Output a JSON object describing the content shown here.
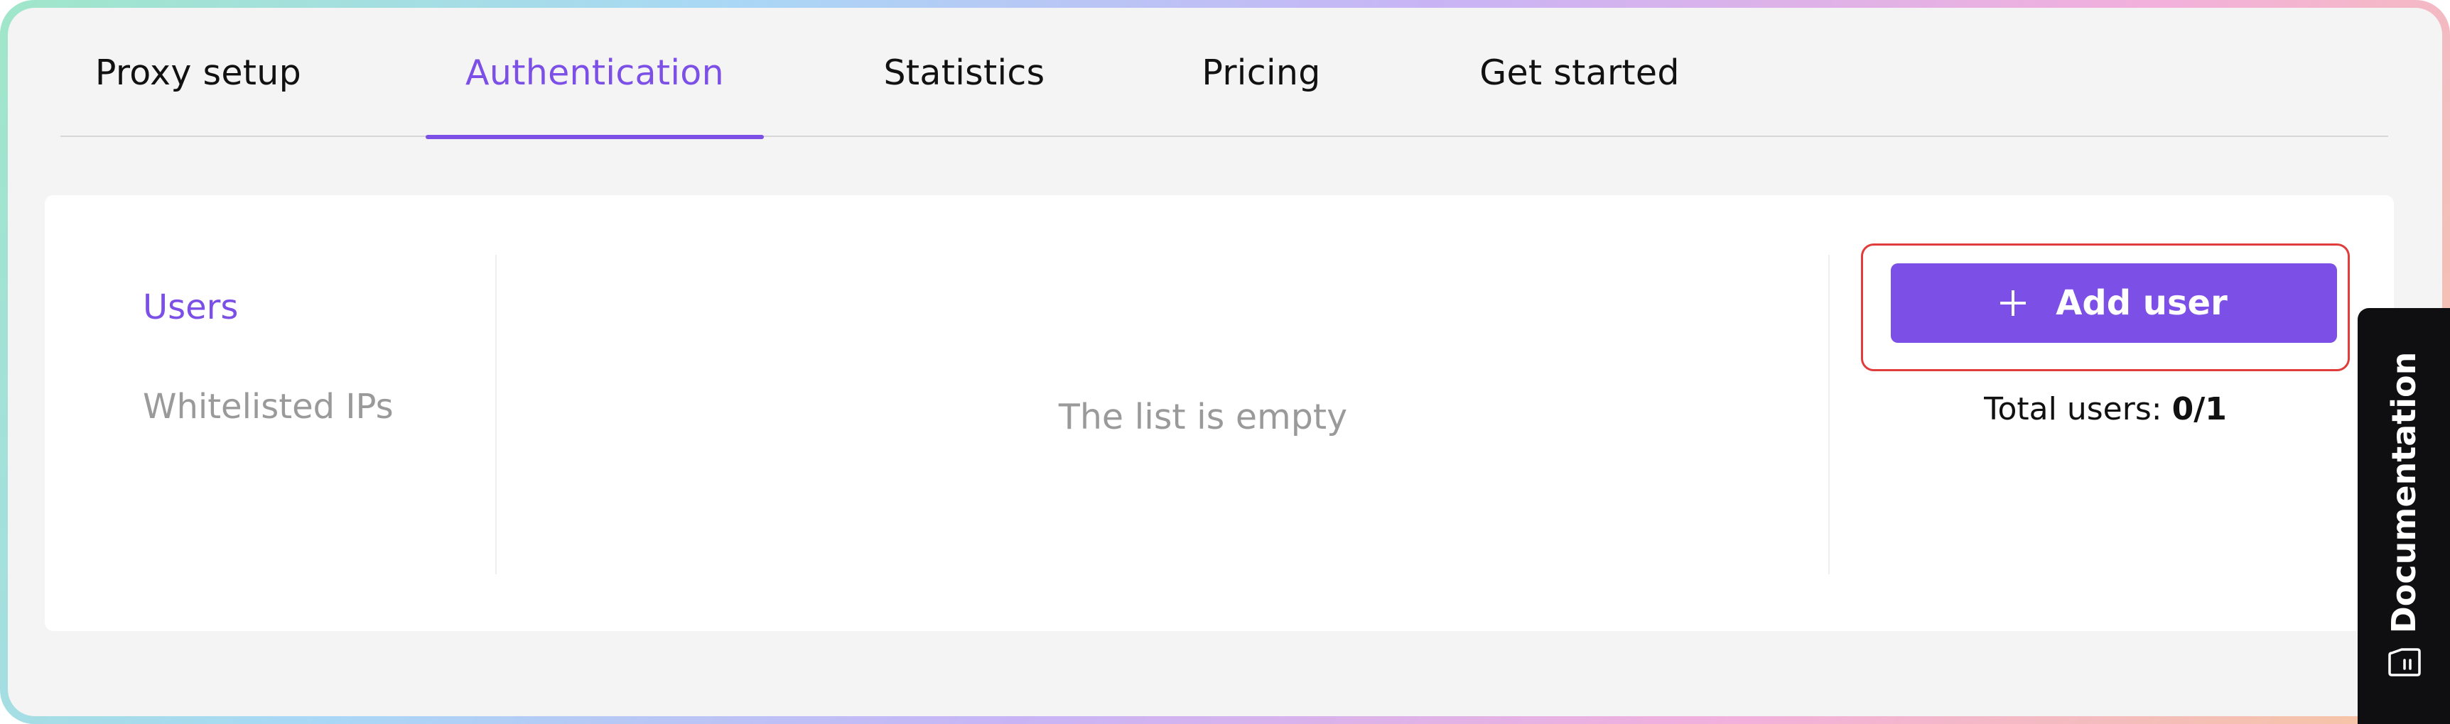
{
  "tabs": [
    {
      "label": "Proxy setup",
      "active": false
    },
    {
      "label": "Authentication",
      "active": true
    },
    {
      "label": "Statistics",
      "active": false
    },
    {
      "label": "Pricing",
      "active": false
    },
    {
      "label": "Get started",
      "active": false
    }
  ],
  "sidebar": {
    "items": [
      {
        "label": "Users",
        "active": true
      },
      {
        "label": "Whitelisted IPs",
        "active": false
      }
    ]
  },
  "main": {
    "empty_text": "The list is empty"
  },
  "actions": {
    "add_user_label": "Add user",
    "total_users_label": "Total users:",
    "total_users_value": "0/1"
  },
  "documentation": {
    "label": "Documentation",
    "icon": "book-icon"
  },
  "colors": {
    "accent": "#7c4fe6",
    "highlight": "#e03c3c",
    "doc_tab_bg": "#0f0f12"
  }
}
